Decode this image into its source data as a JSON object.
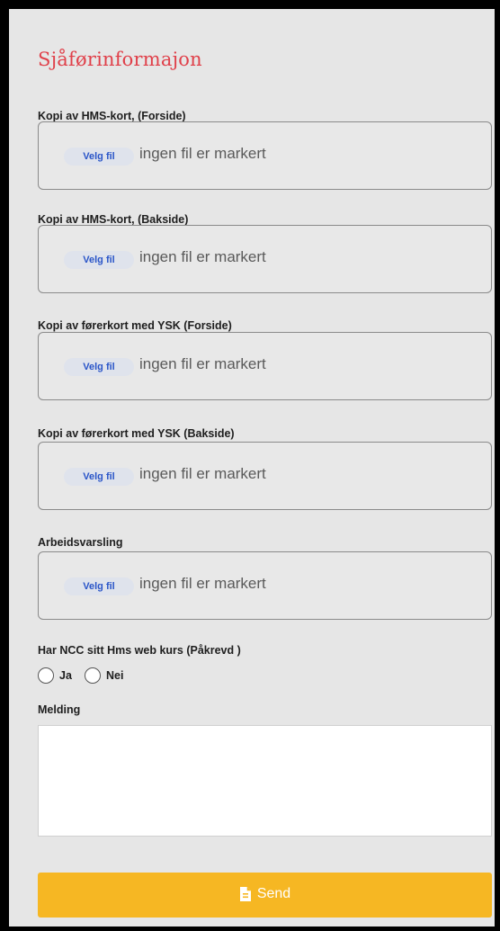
{
  "form": {
    "title": "Sjåførinformajon",
    "file_fields": [
      {
        "label": "Kopi av HMS-kort, (Forside)",
        "button": "Velg fil",
        "status": "ingen fil er markert"
      },
      {
        "label": "Kopi av HMS-kort, (Bakside)",
        "button": "Velg fil",
        "status": "ingen fil er markert"
      },
      {
        "label": "Kopi av førerkort med YSK (Forside)",
        "button": "Velg fil",
        "status": "ingen fil er markert"
      },
      {
        "label": "Kopi av førerkort med YSK (Bakside)",
        "button": "Velg fil",
        "status": "ingen fil er markert"
      },
      {
        "label": "Arbeidsvarsling",
        "button": "Velg fil",
        "status": "ingen fil er markert"
      }
    ],
    "hms_course": {
      "label": "Har NCC sitt Hms web kurs (Påkrevd )",
      "options": [
        "Ja",
        "Nei"
      ],
      "selected": null
    },
    "message": {
      "label": "Melding",
      "value": ""
    },
    "submit": {
      "label": "Send",
      "icon": "file-icon"
    }
  },
  "colors": {
    "title": "#e0404a",
    "accent_button": "#f6b723",
    "file_button_text": "#2a55c8",
    "background": "#e6e6e6"
  }
}
